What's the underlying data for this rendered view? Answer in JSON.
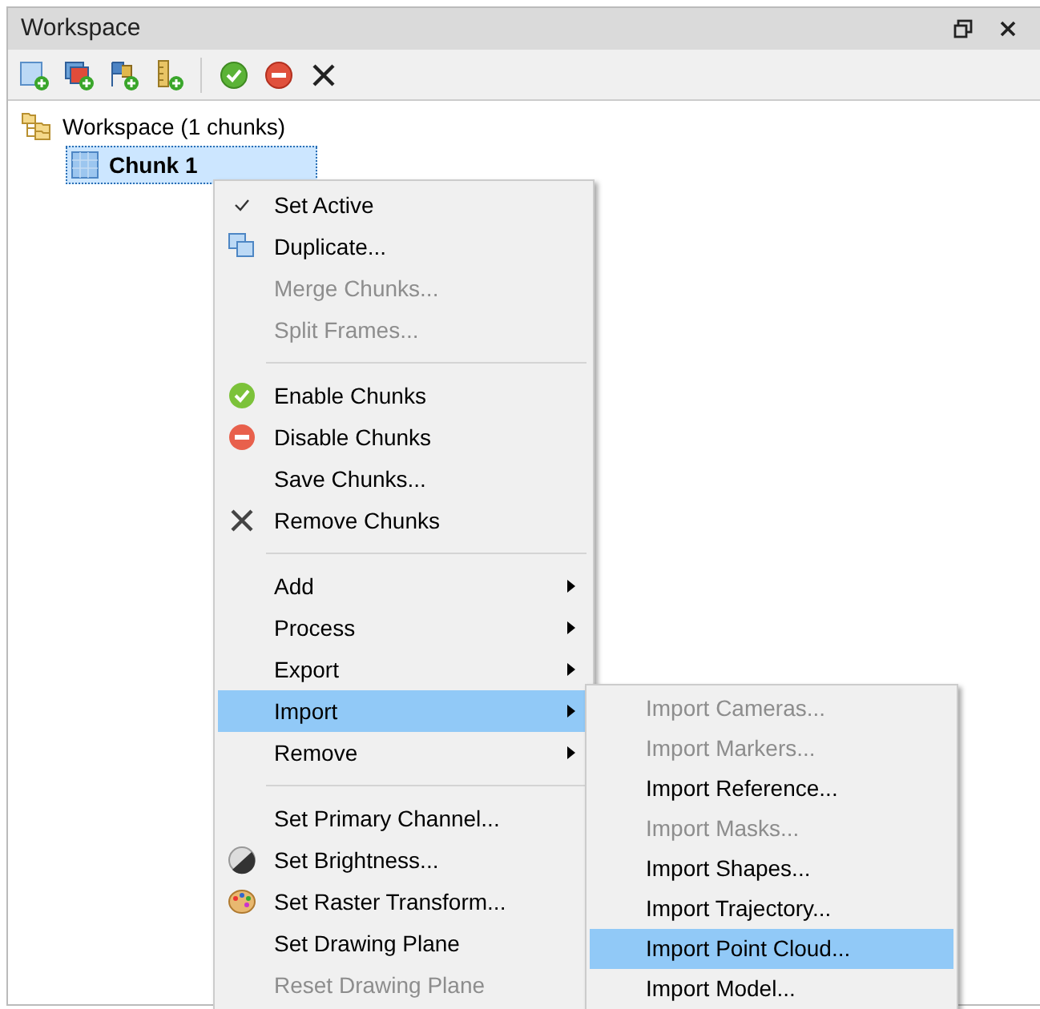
{
  "panel": {
    "title": "Workspace"
  },
  "tree": [
    {
      "label": "Workspace (1 chunks)",
      "selected": false,
      "children": [
        {
          "label": "Chunk 1",
          "selected": true
        }
      ]
    }
  ],
  "context_menu": [
    {
      "kind": "item",
      "label": "Set Active",
      "checked": true,
      "disabled": false,
      "selected": false
    },
    {
      "kind": "item",
      "label": "Duplicate...",
      "disabled": false,
      "selected": false
    },
    {
      "kind": "item",
      "label": "Merge Chunks...",
      "disabled": true,
      "selected": false
    },
    {
      "kind": "item",
      "label": "Split Frames...",
      "disabled": true,
      "selected": false
    },
    {
      "kind": "separator"
    },
    {
      "kind": "item",
      "label": "Enable Chunks",
      "disabled": false,
      "selected": false
    },
    {
      "kind": "item",
      "label": "Disable Chunks",
      "disabled": false,
      "selected": false
    },
    {
      "kind": "item",
      "label": "Save Chunks...",
      "disabled": false,
      "selected": false
    },
    {
      "kind": "item",
      "label": "Remove Chunks",
      "disabled": false,
      "selected": false
    },
    {
      "kind": "separator"
    },
    {
      "kind": "submenu",
      "label": "Add",
      "disabled": false,
      "selected": false
    },
    {
      "kind": "submenu",
      "label": "Process",
      "disabled": false,
      "selected": false
    },
    {
      "kind": "submenu",
      "label": "Export",
      "disabled": false,
      "selected": false
    },
    {
      "kind": "submenu",
      "label": "Import",
      "disabled": false,
      "selected": true
    },
    {
      "kind": "submenu",
      "label": "Remove",
      "disabled": false,
      "selected": false
    },
    {
      "kind": "separator"
    },
    {
      "kind": "item",
      "label": "Set Primary Channel...",
      "disabled": false,
      "selected": false
    },
    {
      "kind": "item",
      "label": "Set Brightness...",
      "disabled": false,
      "selected": false
    },
    {
      "kind": "item",
      "label": "Set Raster Transform...",
      "disabled": false,
      "selected": false
    },
    {
      "kind": "item",
      "label": "Set Drawing Plane",
      "disabled": false,
      "selected": false
    },
    {
      "kind": "item",
      "label": "Reset Drawing Plane",
      "disabled": true,
      "selected": false
    }
  ],
  "import_submenu": [
    {
      "label": "Import Cameras...",
      "disabled": true,
      "selected": false
    },
    {
      "label": "Import Markers...",
      "disabled": true,
      "selected": false
    },
    {
      "label": "Import Reference...",
      "disabled": false,
      "selected": false
    },
    {
      "label": "Import Masks...",
      "disabled": true,
      "selected": false
    },
    {
      "label": "Import Shapes...",
      "disabled": false,
      "selected": false
    },
    {
      "label": "Import Trajectory...",
      "disabled": false,
      "selected": false
    },
    {
      "label": "Import Point Cloud...",
      "disabled": false,
      "selected": true
    },
    {
      "label": "Import Model...",
      "disabled": false,
      "selected": false
    }
  ]
}
